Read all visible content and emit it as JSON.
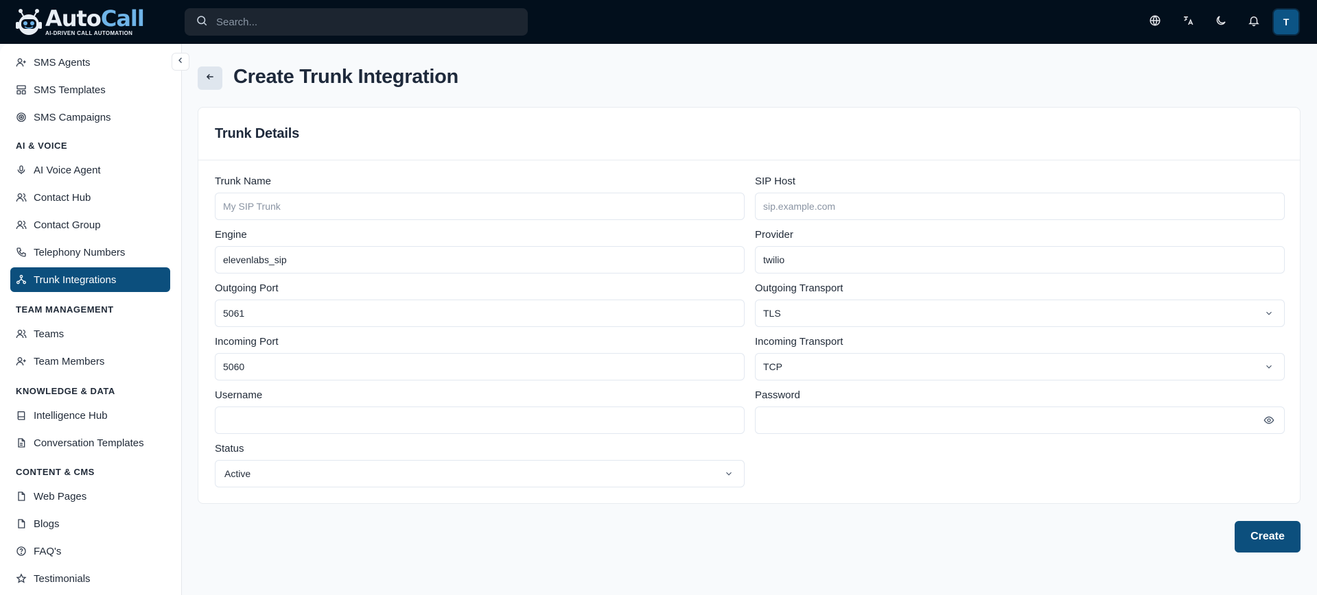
{
  "brand": {
    "name_part1": "Auto",
    "name_part2": "Call",
    "tagline": "AI-DRIVEN CALL AUTOMATION"
  },
  "search": {
    "placeholder": "Search..."
  },
  "user": {
    "initial": "T"
  },
  "sidebar": {
    "items_top": [
      {
        "label": "SMS Agents",
        "icon": "user-plus-icon"
      },
      {
        "label": "SMS Templates",
        "icon": "layout-icon"
      },
      {
        "label": "SMS Campaigns",
        "icon": "target-icon"
      }
    ],
    "sections": [
      {
        "title": "AI & VOICE",
        "items": [
          {
            "label": "AI Voice Agent",
            "icon": "mic-icon"
          },
          {
            "label": "Contact Hub",
            "icon": "users-icon"
          },
          {
            "label": "Contact Group",
            "icon": "users-icon"
          },
          {
            "label": "Telephony Numbers",
            "icon": "phone-icon"
          },
          {
            "label": "Trunk Integrations",
            "icon": "network-icon",
            "active": true
          }
        ]
      },
      {
        "title": "TEAM MANAGEMENT",
        "items": [
          {
            "label": "Teams",
            "icon": "users-icon"
          },
          {
            "label": "Team Members",
            "icon": "user-plus-icon"
          }
        ]
      },
      {
        "title": "KNOWLEDGE & DATA",
        "items": [
          {
            "label": "Intelligence Hub",
            "icon": "book-icon"
          },
          {
            "label": "Conversation Templates",
            "icon": "file-text-icon"
          }
        ]
      },
      {
        "title": "CONTENT & CMS",
        "items": [
          {
            "label": "Web Pages",
            "icon": "file-icon"
          },
          {
            "label": "Blogs",
            "icon": "file-icon"
          },
          {
            "label": "FAQ's",
            "icon": "help-circle-icon"
          },
          {
            "label": "Testimonials",
            "icon": "star-icon"
          }
        ]
      }
    ]
  },
  "page": {
    "title": "Create Trunk Integration",
    "card_title": "Trunk Details",
    "create_label": "Create"
  },
  "form": {
    "trunk_name": {
      "label": "Trunk Name",
      "placeholder": "My SIP Trunk",
      "value": ""
    },
    "sip_host": {
      "label": "SIP Host",
      "placeholder": "sip.example.com",
      "value": ""
    },
    "engine": {
      "label": "Engine",
      "value": "elevenlabs_sip"
    },
    "provider": {
      "label": "Provider",
      "value": "twilio"
    },
    "outgoing_port": {
      "label": "Outgoing Port",
      "value": "5061"
    },
    "outgoing_transport": {
      "label": "Outgoing Transport",
      "value": "TLS"
    },
    "incoming_port": {
      "label": "Incoming Port",
      "value": "5060"
    },
    "incoming_transport": {
      "label": "Incoming Transport",
      "value": "TCP"
    },
    "username": {
      "label": "Username",
      "value": ""
    },
    "password": {
      "label": "Password",
      "value": ""
    },
    "status": {
      "label": "Status",
      "value": "Active"
    }
  },
  "colors": {
    "topbar": "#020f1c",
    "primary": "#0c4f7d",
    "page_bg": "#f8fafc"
  }
}
